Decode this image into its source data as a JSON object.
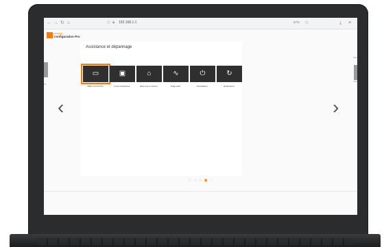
{
  "browser": {
    "nav": {
      "back": "←",
      "forward": "→",
      "reload": "↻",
      "home": "⌂"
    },
    "url": "192.168.1.1",
    "zoom": "67%",
    "toolbar": {
      "star": "☆",
      "download": "⤓",
      "menu": "≡"
    }
  },
  "brand": {
    "line1": "orange",
    "line2": "configuration Pro"
  },
  "card": {
    "title": "Assistance et dépannage",
    "tiles": [
      {
        "label": "Wifiin Control Pro",
        "icon": "wifi-router-icon",
        "glyph": "▭"
      },
      {
        "label": "Accès assistance",
        "icon": "devices-icon",
        "glyph": "▣"
      },
      {
        "label": "Mise à jour Livebox",
        "icon": "home-update-icon",
        "glyph": "⌂"
      },
      {
        "label": "Diagnostic",
        "icon": "pulse-icon",
        "glyph": "∿"
      },
      {
        "label": "Réinitialiser",
        "icon": "power-icon",
        "glyph": "⏻"
      },
      {
        "label": "Redémarrer",
        "icon": "restart-icon",
        "glyph": "↻"
      }
    ]
  },
  "arrows": {
    "prev": "‹",
    "next": "›"
  },
  "side": {
    "right_top": "Parc",
    "right_bottom": "Déb",
    "left": "ert"
  },
  "pager_dots": [
    "♡",
    "⌂",
    "◌",
    "◉",
    "◌"
  ],
  "colors": {
    "accent": "#ff7900",
    "tile": "#2f2f2f"
  }
}
